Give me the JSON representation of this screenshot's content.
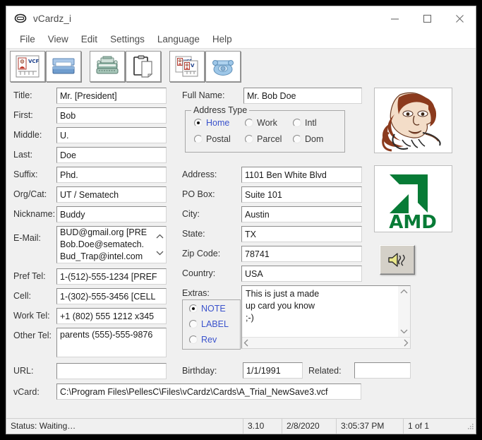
{
  "window": {
    "title": "vCardz_i",
    "icon": "app-icon",
    "controls": {
      "minimize": "—",
      "maximize": "□",
      "close": "✕"
    }
  },
  "menu": {
    "items": [
      {
        "label": "File"
      },
      {
        "label": "View"
      },
      {
        "label": "Edit"
      },
      {
        "label": "Settings"
      },
      {
        "label": "Language"
      },
      {
        "label": "Help"
      }
    ]
  },
  "toolbar": {
    "groups": [
      {
        "buttons": [
          {
            "name": "vcf-card-icon",
            "title": "VCF"
          },
          {
            "name": "open-folder-icon",
            "title": "Open"
          }
        ]
      },
      {
        "buttons": [
          {
            "name": "typewriter-icon",
            "title": "Typewriter"
          },
          {
            "name": "clipboard-icon",
            "title": "Clipboard"
          }
        ]
      },
      {
        "buttons": [
          {
            "name": "multi-card-icon",
            "title": "Cards"
          },
          {
            "name": "telephone-icon",
            "title": "Phone"
          }
        ]
      }
    ]
  },
  "form": {
    "left": {
      "title": {
        "label": "Title:",
        "value": "Mr.  [President]"
      },
      "first": {
        "label": "First:",
        "value": "Bob"
      },
      "middle": {
        "label": "Middle:",
        "value": "U."
      },
      "last": {
        "label": "Last:",
        "value": "Doe"
      },
      "suffix": {
        "label": "Suffix:",
        "value": "Phd."
      },
      "orgcat": {
        "label": "Org/Cat:",
        "value": "UT / Sematech"
      },
      "nickname": {
        "label": "Nickname:",
        "value": "Buddy"
      },
      "email": {
        "label": "E-Mail:",
        "items": [
          "BUD@gmail.org [PRE",
          "Bob.Doe@sematech.",
          "Bud_Trap@intel.com"
        ]
      },
      "pref_tel": {
        "label": "Pref Tel:",
        "value": "1-(512)-555-1234 [PREF"
      },
      "cell": {
        "label": "Cell:",
        "value": "1-(302)-555-3456 [CELL"
      },
      "work_tel": {
        "label": "Work Tel:",
        "value": "+1 (802) 555 1212 x345"
      },
      "other_tel": {
        "label": "Other Tel:",
        "value": "parents (555)-555-9876"
      },
      "url": {
        "label": "URL:",
        "value": ""
      }
    },
    "middle": {
      "full_name": {
        "label": "Full Name:",
        "value": "Mr. Bob Doe"
      },
      "address_type": {
        "legend": "Address Type",
        "options": [
          {
            "label": "Home",
            "selected": true
          },
          {
            "label": "Work",
            "selected": false
          },
          {
            "label": "Intl",
            "selected": false
          },
          {
            "label": "Postal",
            "selected": false
          },
          {
            "label": "Parcel",
            "selected": false
          },
          {
            "label": "Dom",
            "selected": false
          }
        ]
      },
      "address": {
        "label": "Address:",
        "value": "1101 Ben White Blvd"
      },
      "po_box": {
        "label": "PO Box:",
        "value": "Suite 101"
      },
      "city": {
        "label": "City:",
        "value": "Austin"
      },
      "state": {
        "label": "State:",
        "value": "TX"
      },
      "zip": {
        "label": "Zip Code:",
        "value": "78741"
      },
      "country": {
        "label": "Country:",
        "value": "USA"
      },
      "extras": {
        "label": "Extras:",
        "options": [
          {
            "label": "NOTE",
            "selected": true
          },
          {
            "label": "LABEL",
            "selected": false
          },
          {
            "label": "Rev",
            "selected": false
          }
        ],
        "text": "This is just a made\nup card you know\n;-)"
      },
      "birthday": {
        "label": "Birthday:",
        "value": "1/1/1991"
      },
      "related": {
        "label": "Related:",
        "value": ""
      }
    },
    "right": {
      "photo": {
        "name": "contact-photo",
        "alt": "sketch of person on telephone"
      },
      "logo": {
        "name": "amd-logo",
        "alt": "AMD",
        "text": "AMD",
        "color": "#077b36"
      },
      "sound": {
        "name": "sound-button",
        "alt": "play sound"
      }
    },
    "vcard": {
      "label": "vCard:",
      "value": "C:\\Program Files\\PellesC\\Files\\vCardz\\Cards\\A_Trial_NewSave3.vcf"
    }
  },
  "statusbar": {
    "status": "Status: Waiting…",
    "version": "3.10",
    "date": "2/8/2020",
    "time": "3:05:37 PM",
    "count": "1 of 1"
  }
}
